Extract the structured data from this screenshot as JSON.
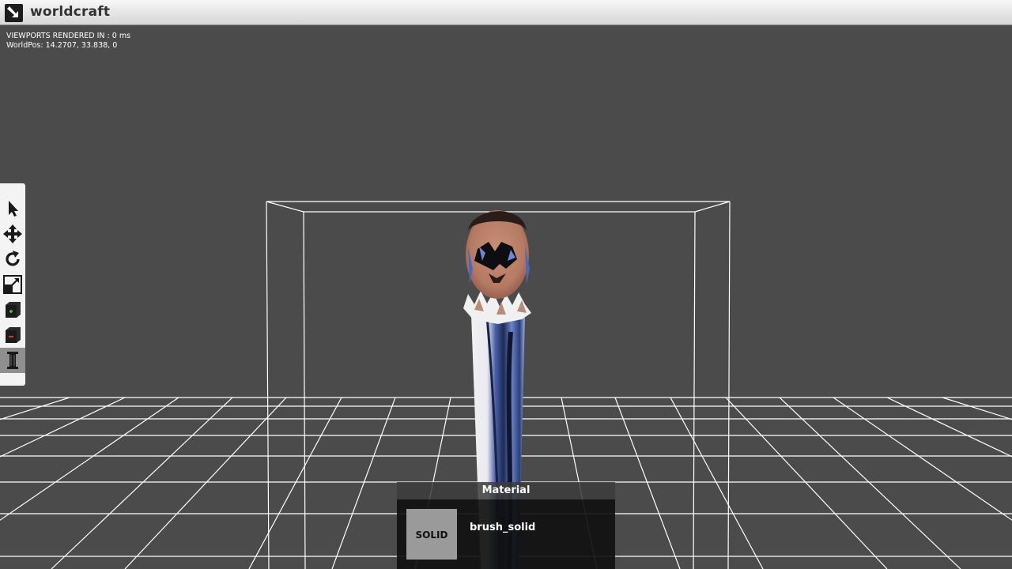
{
  "app": {
    "title": "worldcraft",
    "logo_icon": "worldcraft-logo-icon"
  },
  "viewport": {
    "stats_render": "VIEWPORTS RENDERED IN : 0 ms",
    "stats_worldpos": "WorldPos: 14.2707, 33.838, 0",
    "background_color": "#4b4b4b",
    "grid_color": "#ffffff"
  },
  "toolbar": {
    "tools": [
      {
        "name": "select-tool",
        "icon": "cursor-arrow-icon",
        "active": false
      },
      {
        "name": "move-tool",
        "icon": "move-arrows-icon",
        "active": false
      },
      {
        "name": "rotate-tool",
        "icon": "rotate-icon",
        "active": false
      },
      {
        "name": "scale-tool",
        "icon": "scale-icon",
        "active": false
      },
      {
        "name": "add-brush-tool",
        "icon": "cube-plus-icon",
        "active": false
      },
      {
        "name": "subtract-brush-tool",
        "icon": "cube-minus-icon",
        "active": false
      },
      {
        "name": "pillar-tool",
        "icon": "pillar-icon",
        "active": true
      }
    ]
  },
  "material": {
    "header": "Material",
    "swatch_label": "SOLID",
    "name": "brush_solid"
  }
}
